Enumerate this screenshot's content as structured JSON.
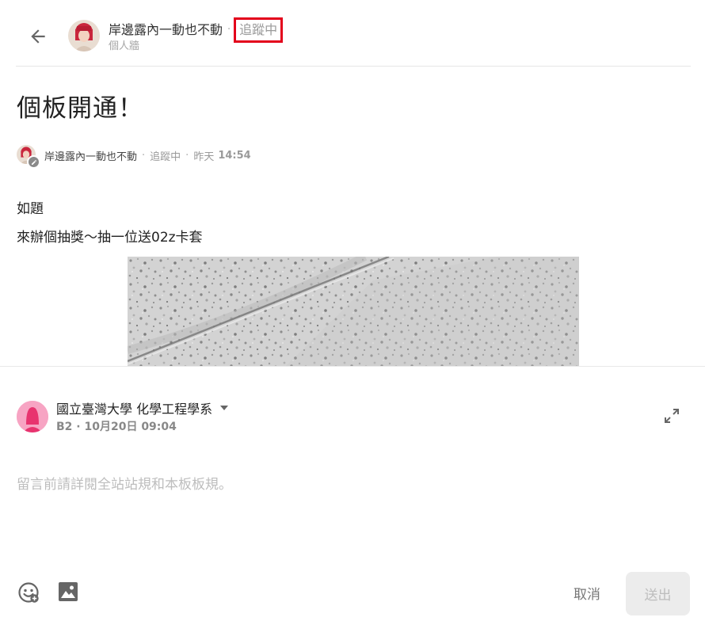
{
  "header": {
    "author_name": "岸邊露內一動也不動",
    "follow_status": "追蹤中",
    "subtitle": "個人牆",
    "separator": "·"
  },
  "post": {
    "title": "個板開通！",
    "meta": {
      "author_name": "岸邊露內一動也不動",
      "follow_status": "追蹤中",
      "day": "昨天",
      "time": "14:54",
      "separator": "·"
    },
    "body_lines": [
      "如題",
      "來辦個抽獎～抽一位送02z卡套"
    ]
  },
  "composer": {
    "identity_label": "國立臺灣大學 化學工程學系",
    "sub_label": "B2 · 10月20日 09:04",
    "placeholder": "留言前請詳閱全站站規和本板板規。",
    "cancel_label": "取消",
    "send_label": "送出"
  },
  "colors": {
    "highlight_border": "#e3001b",
    "avatar_pink": "#f7a4c3",
    "avatar_figure": "#e8336f",
    "muted_text": "#9a9a9a",
    "send_button_bg": "#ececec"
  },
  "icons": {
    "back": "arrow-left-icon",
    "expand": "expand-icon",
    "emoji": "smiley-icon",
    "image": "image-icon",
    "edit_badge": "pencil-icon",
    "caret": "caret-down-icon"
  }
}
